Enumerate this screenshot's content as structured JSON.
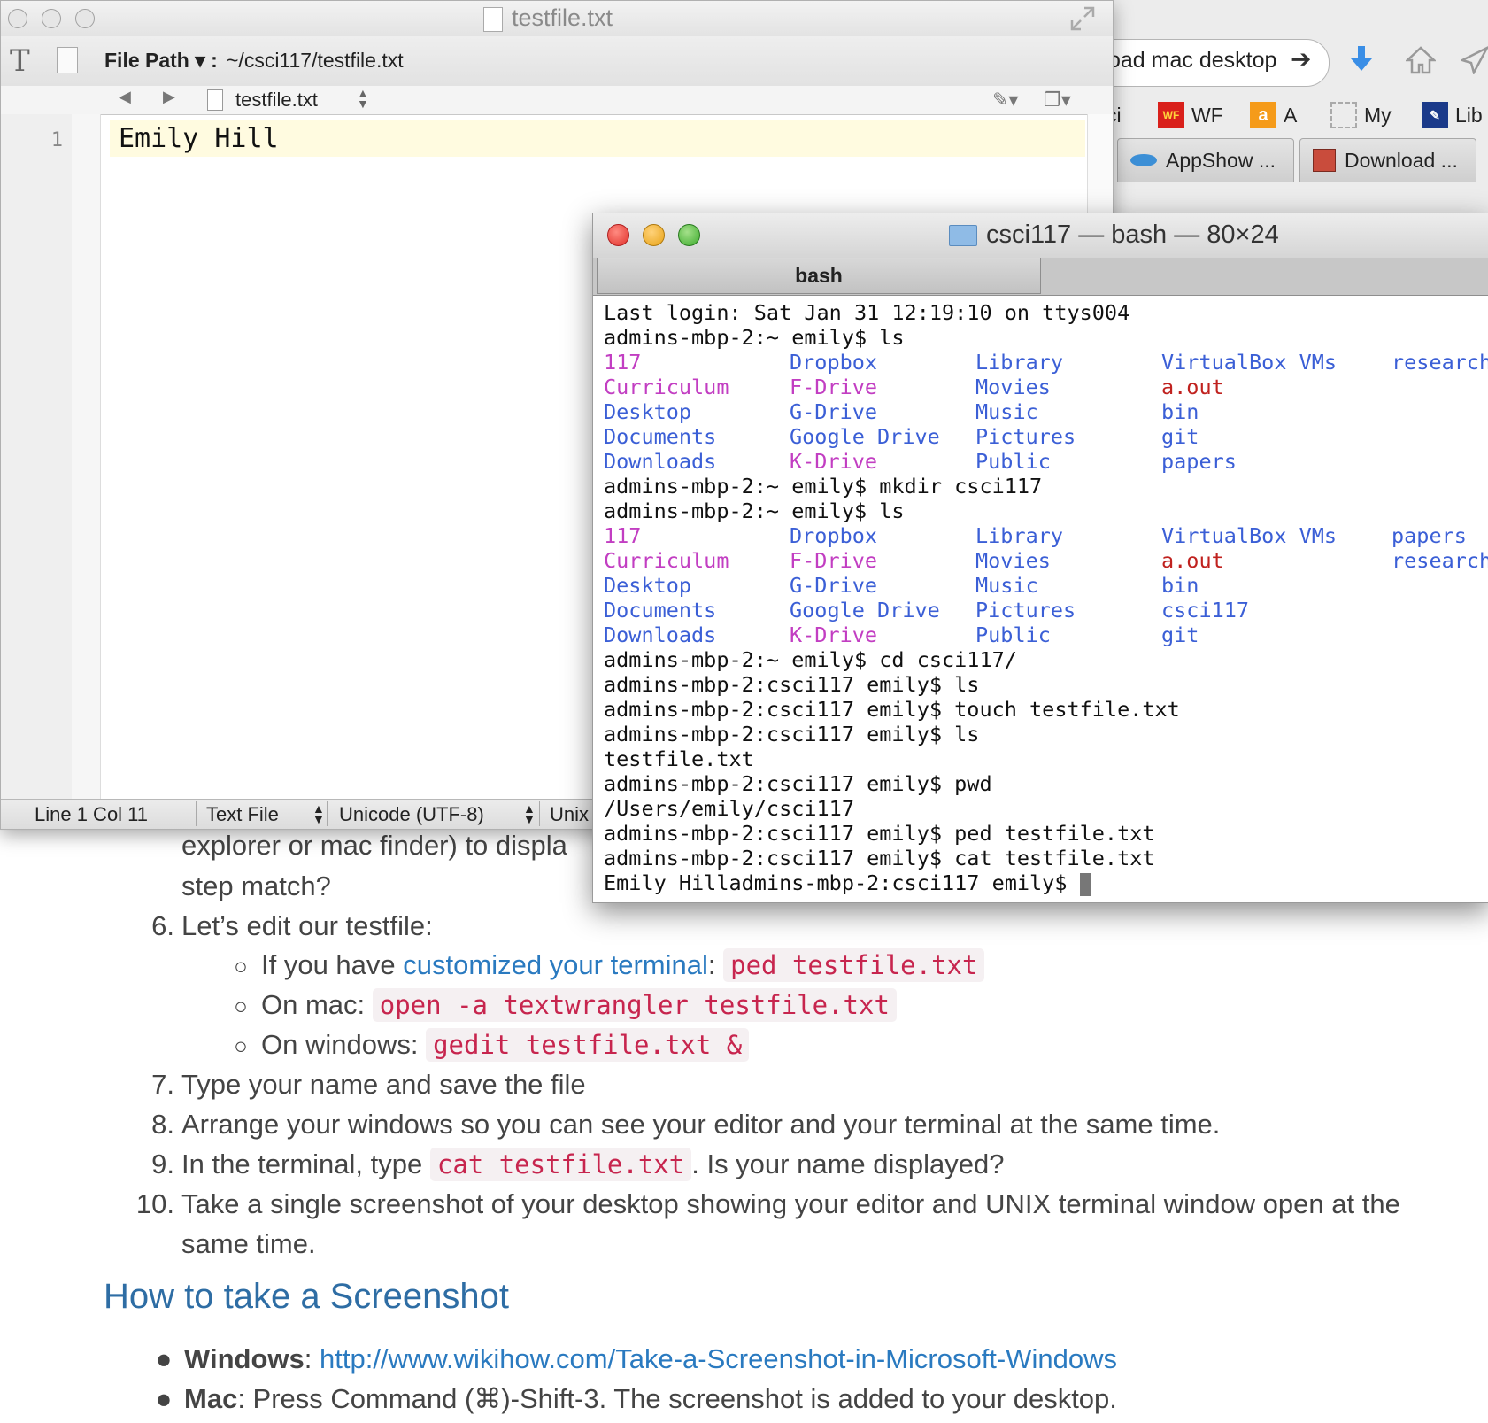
{
  "browser": {
    "url_text": "oad mac desktop",
    "bookmarks": [
      "ci",
      "WF",
      "A",
      "My",
      "Lib"
    ],
    "bookmark_icon_labels": {
      "wf": "WF",
      "a": "a"
    },
    "tabs": [
      "AppShow ...",
      "Download ..."
    ]
  },
  "editor": {
    "title": "testfile.txt",
    "file_path_label": "File Path ▾ :",
    "file_path": "~/csci117/testfile.txt",
    "nav_filename": "testfile.txt",
    "line_number": "1",
    "content": "Emily Hill",
    "status": {
      "position": "Line 1 Col 11",
      "file_type": "Text File",
      "encoding": "Unicode (UTF-8)",
      "line_endings": "Unix"
    }
  },
  "terminal": {
    "title": "csci117 — bash — 80×24",
    "tab": "bash",
    "lines": {
      "l1": "Last login: Sat Jan 31 12:19:10 on ttys004",
      "l2": "admins-mbp-2:~ emily$ ls",
      "l8": "admins-mbp-2:~ emily$ mkdir csci117",
      "l9": "admins-mbp-2:~ emily$ ls",
      "l15": "admins-mbp-2:~ emily$ cd csci117/",
      "l16": "admins-mbp-2:csci117 emily$ ls",
      "l17": "admins-mbp-2:csci117 emily$ touch testfile.txt",
      "l18": "admins-mbp-2:csci117 emily$ ls",
      "l19": "testfile.txt",
      "l20": "admins-mbp-2:csci117 emily$ pwd",
      "l21": "/Users/emily/csci117",
      "l22": "admins-mbp-2:csci117 emily$ ped testfile.txt",
      "l23": "admins-mbp-2:csci117 emily$ cat testfile.txt",
      "l24": "Emily Hilladmins-mbp-2:csci117 emily$ "
    },
    "ls1": [
      [
        "117",
        "Dropbox",
        "Library",
        "VirtualBox VMs",
        "research"
      ],
      [
        "Curriculum",
        "F-Drive",
        "Movies",
        "a.out",
        ""
      ],
      [
        "Desktop",
        "G-Drive",
        "Music",
        "bin",
        ""
      ],
      [
        "Documents",
        "Google Drive",
        "Pictures",
        "git",
        ""
      ],
      [
        "Downloads",
        "K-Drive",
        "Public",
        "papers",
        ""
      ]
    ],
    "ls2": [
      [
        "117",
        "Dropbox",
        "Library",
        "VirtualBox VMs",
        "papers"
      ],
      [
        "Curriculum",
        "F-Drive",
        "Movies",
        "a.out",
        "research"
      ],
      [
        "Desktop",
        "G-Drive",
        "Music",
        "bin",
        ""
      ],
      [
        "Documents",
        "Google Drive",
        "Pictures",
        "csci117",
        ""
      ],
      [
        "Downloads",
        "K-Drive",
        "Public",
        "git",
        ""
      ]
    ]
  },
  "webpage": {
    "frag1": "explorer or mac finder) to displa",
    "frag2": "step match?",
    "step6_num": "6.",
    "step6": "Let’s edit our testfile:",
    "sub1_pre": "If you have ",
    "sub1_link": "customized your terminal",
    "sub1_colon": ":",
    "sub1_code": "ped testfile.txt",
    "sub2_pre": "On mac: ",
    "sub2_code": "open -a textwrangler testfile.txt",
    "sub3_pre": "On windows: ",
    "sub3_code": "gedit testfile.txt &",
    "step7_num": "7.",
    "step7": "Type your name and save the file",
    "step8_num": "8.",
    "step8": "Arrange your windows so you can see your editor and your terminal at the same time.",
    "step9_num": "9.",
    "step9_pre": "In the terminal, type ",
    "step9_code": "cat testfile.txt",
    "step9_post": ". Is your name displayed?",
    "step10_num": "10.",
    "step10_line1": "Take a single screenshot of your desktop showing your editor and UNIX terminal window open at the",
    "step10_line2": "same time.",
    "heading": "How to take a Screenshot",
    "win_label": "Windows",
    "win_colon": ": ",
    "win_link": "http://www.wikihow.com/Take-a-Screenshot-in-Microsoft-Windows",
    "mac_label": "Mac",
    "mac_text": ": Press Command (⌘)-Shift-3. The screenshot is added to your desktop."
  },
  "colors": {
    "exec_purple": "#c23ec2",
    "dir_blue": "#3b5fd6",
    "red": "#c0221f",
    "link_blue": "#2a7ac0",
    "code_red": "#c7254e",
    "heading_blue": "#2e6da4"
  }
}
